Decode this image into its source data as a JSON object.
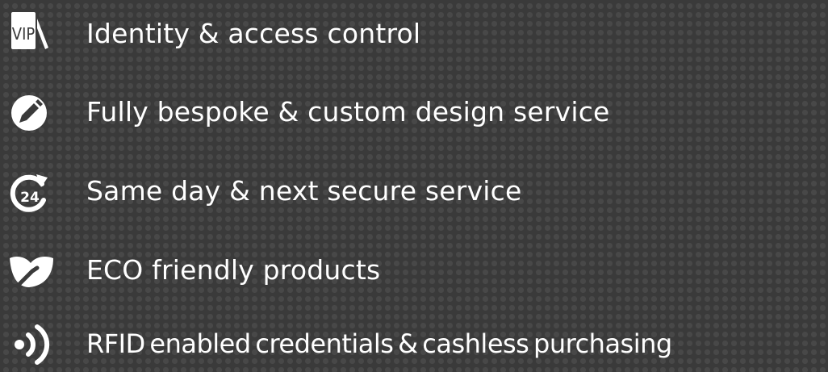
{
  "features": [
    {
      "icon": "vip-pass-icon",
      "label": "Identity & access control"
    },
    {
      "icon": "pencil-icon",
      "label": "Fully bespoke & custom design service"
    },
    {
      "icon": "clock-24-icon",
      "label": "Same day & next secure service"
    },
    {
      "icon": "leaf-icon",
      "label": "ECO friendly products"
    },
    {
      "icon": "rfid-signal-icon",
      "label": "RFID enabled credentials & cashless purchasing"
    }
  ],
  "icon_text": {
    "vip": "VIP",
    "hours": "24"
  },
  "colors": {
    "background": "#3a3a3a",
    "dots": "#484848",
    "text": "#ffffff"
  }
}
